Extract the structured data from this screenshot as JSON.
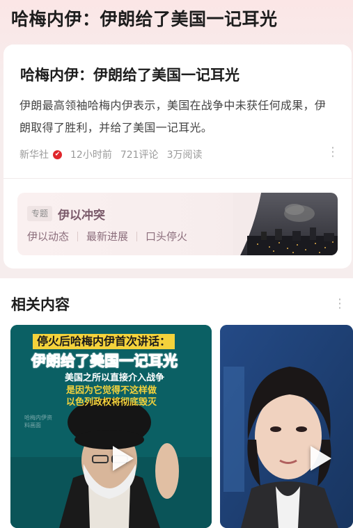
{
  "header": {
    "title": "哈梅内伊：伊朗给了美国一记耳光"
  },
  "article": {
    "title": "哈梅内伊：伊朗给了美国一记耳光",
    "summary": "伊朗最高领袖哈梅内伊表示，美国在战争中未获任何成果，伊朗取得了胜利，并给了美国一记耳光。",
    "source": "新华社",
    "verified_icon": "verified-badge-icon",
    "time": "12小时前",
    "comments": "721评论",
    "reads": "3万阅读",
    "more_icon": "more-vertical-icon"
  },
  "topic": {
    "tag": "专题",
    "name": "伊以冲突",
    "links": [
      "伊以动态",
      "最新进展",
      "口头停火"
    ]
  },
  "related": {
    "title": "相关内容",
    "more_icon": "more-vertical-icon",
    "videos": [
      {
        "overlay_line1": "停火后哈梅内伊首次讲话：",
        "overlay_line2": "伊朗给了美国一记耳光",
        "overlay_line3": "美国之所以直接介入战争",
        "overlay_line4": "是因为它觉得不这样做",
        "overlay_line5": "以色列政权将彻底毁灭",
        "watermark": "哈梅内伊资料画面",
        "play_icon": "play-icon"
      },
      {
        "play_icon": "play-icon"
      }
    ]
  },
  "colors": {
    "accent_red": "#e0262b",
    "caption_yellow": "#f4d23b",
    "topic_purple": "#7a5a6a"
  }
}
